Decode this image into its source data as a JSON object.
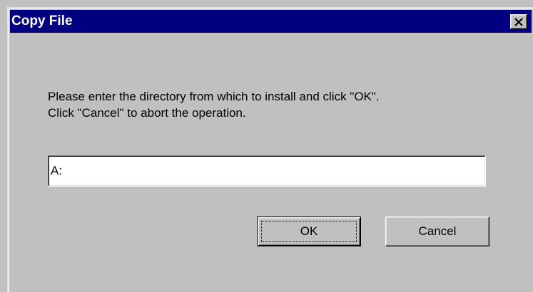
{
  "dialog": {
    "title": "Copy File",
    "close_icon": "close-icon",
    "message_lines": [
      "Please enter the directory from which to install and click \"OK\".",
      "Click \"Cancel\" to abort the operation."
    ],
    "directory_value": "A:",
    "ok_label": "OK",
    "cancel_label": "Cancel"
  },
  "colors": {
    "titlebar": "#000080",
    "face": "#c0c0c0",
    "title_text": "#ffffff"
  }
}
